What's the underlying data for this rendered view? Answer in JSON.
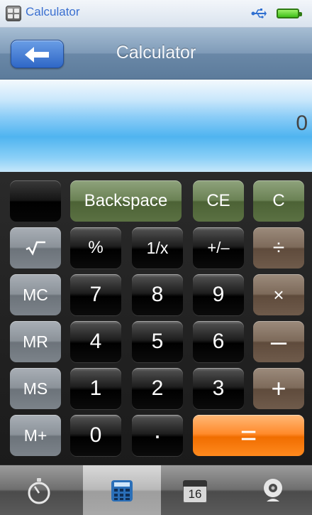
{
  "status_bar": {
    "app_title": "Calculator"
  },
  "header": {
    "title": "Calculator"
  },
  "display": {
    "value": "0"
  },
  "keypad": {
    "backspace": "Backspace",
    "ce": "CE",
    "c": "C",
    "percent": "%",
    "reciprocal": "1/x",
    "plus_minus": "+/–",
    "divide": "÷",
    "mc": "MC",
    "mr": "MR",
    "ms": "MS",
    "m_plus": "M+",
    "seven": "7",
    "eight": "8",
    "nine": "9",
    "four": "4",
    "five": "5",
    "six": "6",
    "one": "1",
    "two": "2",
    "three": "3",
    "zero": "0",
    "decimal": "·",
    "multiply": "×",
    "minus": "–",
    "plus": "+",
    "equals": "="
  },
  "tab_bar": {
    "calendar_date": "16",
    "active_tab": "calculator"
  },
  "colors": {
    "equals_orange": "#ff8a1e",
    "clear_green": "#6b8255",
    "operator_brown": "#7d6a5a",
    "display_blue": "#4fb4f0",
    "back_button_blue": "#2f67c6"
  }
}
